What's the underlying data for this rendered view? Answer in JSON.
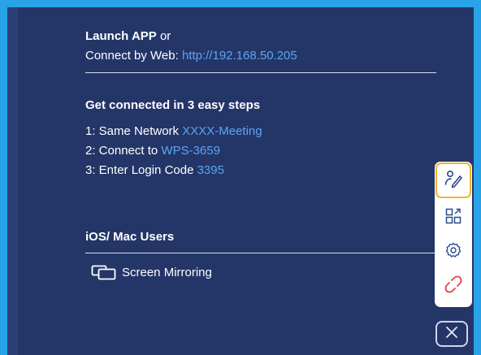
{
  "launch": {
    "line1_bold": "Launch APP",
    "line1_rest": " or",
    "line2_prefix": "Connect by Web: ",
    "url": "http://192.168.50.205"
  },
  "steps": {
    "heading": "Get connected in 3 easy steps",
    "items": [
      {
        "prefix": "1: Same Network ",
        "value": "XXXX-Meeting"
      },
      {
        "prefix": "2: Connect to ",
        "value": "WPS-3659"
      },
      {
        "prefix": "3: Enter Login Code ",
        "value": "3395"
      }
    ]
  },
  "ios": {
    "heading": "iOS/ Mac Users",
    "mirroring_label": "Screen Mirroring"
  },
  "toolbar": {
    "icons": [
      "annotate-icon",
      "qr-code-icon",
      "settings-gear-icon",
      "disconnect-link-icon",
      "close-icon"
    ]
  },
  "colors": {
    "background": "#243568",
    "accent_link": "#5aa7ef",
    "active_border": "#f2b62d",
    "disconnect_red": "#e8414b",
    "frame_blue": "#29a3e8"
  }
}
